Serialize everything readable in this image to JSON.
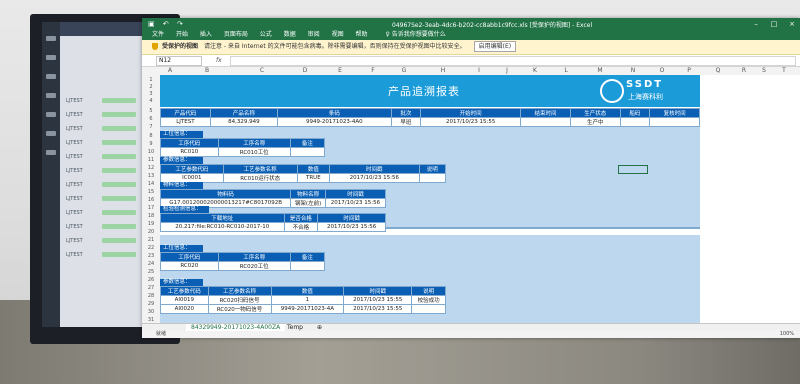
{
  "window": {
    "title": "04967Se2-3eab-4dc6-b202-cc8abb1c9fcc.xls [受保护的视图] - Excel",
    "qa_icons": [
      "save-icon",
      "undo-icon",
      "redo-icon"
    ]
  },
  "ribbon": {
    "tabs": [
      "文件",
      "开始",
      "插入",
      "页面布局",
      "公式",
      "数据",
      "审阅",
      "视图",
      "帮助"
    ],
    "tell_me": "告诉我你想要做什么"
  },
  "protected_view": {
    "label": "受保护的视图",
    "message": "请注意 - 来自 Internet 的文件可能包含病毒。除非需要编辑，否则保持在受保护视图中比较安全。",
    "enable_button": "启用编辑(E)"
  },
  "formula_bar": {
    "name_box": "N12",
    "fx": "fx",
    "value": ""
  },
  "columns": [
    "A",
    "B",
    "C",
    "D",
    "E",
    "F",
    "G",
    "H",
    "I",
    "J",
    "K",
    "L",
    "M",
    "N",
    "O",
    "P",
    "Q",
    "R",
    "S",
    "T"
  ],
  "rows": [
    "1",
    "2",
    "3",
    "4",
    "5",
    "6",
    "7",
    "8",
    "9",
    "10",
    "11",
    "12",
    "13",
    "14",
    "15",
    "16",
    "17",
    "18",
    "19",
    "20",
    "21",
    "22",
    "23",
    "24",
    "25",
    "26",
    "27",
    "28",
    "29",
    "30",
    "31",
    "32",
    "33",
    "34"
  ],
  "report": {
    "title": "产品追溯报表",
    "logo_brand": "SSDT",
    "logo_cn": "上海赛科利",
    "product_header": [
      "产品代码",
      "产品名称",
      "条码",
      "批次",
      "开始时间",
      "结束时间",
      "生产状态",
      "船码",
      "复核时间"
    ],
    "product_values": [
      "LJTEST",
      "84,329.949",
      "9949-20171023-4A0",
      "",
      "早班",
      "2017/10/23 15:55",
      "",
      "生产中",
      ""
    ],
    "sec_station1": "工位信息：",
    "station_header": [
      "工序代码",
      "工序名称",
      "备注"
    ],
    "station1_values": [
      "RC010",
      "RC010工位",
      ""
    ],
    "sec_params": "参数信息：",
    "params_header": [
      "工艺参数代码",
      "工艺参数名称",
      "数值",
      "时间戳",
      "说明"
    ],
    "params_values": [
      "IC0001",
      "RC010运行状态",
      "TRUE",
      "2017/10/23 15:56",
      ""
    ],
    "sec_material": "物料信息：",
    "material_header": [
      "物料码",
      "物料名称",
      "时间戳"
    ],
    "material_values": [
      "G17.001200020000013217#C8017092B",
      "钢架(左前)",
      "2017/10/23 15:56"
    ],
    "sec_inspect": "检验检测信息：",
    "inspect_header": [
      "下载地址",
      "是否合格",
      "时间戳"
    ],
    "inspect_values": [
      "20.217:file:RC010-RC010-2017-10",
      "不合格",
      "2017/10/23 15:56"
    ],
    "sec_station2": "工位信息：",
    "station2_values": [
      "RC020",
      "RC020工位",
      ""
    ],
    "sec_params2": "参数信息：",
    "params2_rows": [
      [
        "AI0019",
        "RC020扫码信号",
        "1",
        "2017/10/23 15:55",
        "校验成功"
      ],
      [
        "AI0020",
        "RC020一物码信号",
        "9949-20171023-4A",
        "2017/10/23 15:55",
        ""
      ]
    ]
  },
  "sheet_tabs": [
    "84329949-20171023-4A00ZA",
    "Temp"
  ],
  "status": {
    "left": "就绪",
    "zoom": "100%"
  }
}
